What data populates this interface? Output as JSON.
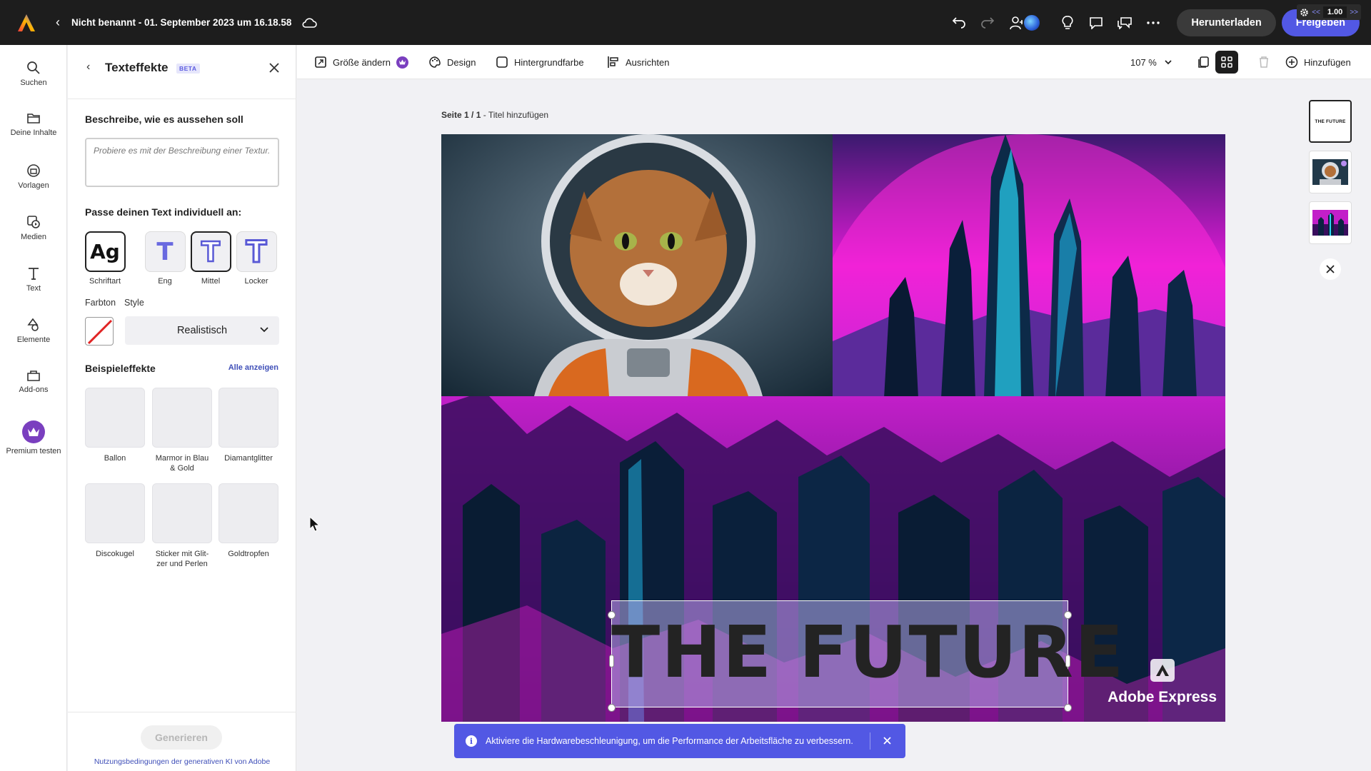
{
  "topbar": {
    "title": "Nicht benannt - 01. September 2023 um 16.18.58",
    "download_label": "Herunterladen",
    "share_label": "Freigeben",
    "speed_value": "1.00",
    "speed_prev": "<<",
    "speed_next": ">>"
  },
  "rail": {
    "items": [
      {
        "label": "Suchen",
        "icon": "search-icon"
      },
      {
        "label": "Deine Inhalte",
        "icon": "folder-icon"
      },
      {
        "label": "Vorlagen",
        "icon": "templates-icon"
      },
      {
        "label": "Medien",
        "icon": "media-icon"
      },
      {
        "label": "Text",
        "icon": "text-icon"
      },
      {
        "label": "Elemente",
        "icon": "elements-icon"
      },
      {
        "label": "Add-ons",
        "icon": "addons-icon"
      },
      {
        "label": "Premium testen",
        "icon": "crown-icon"
      }
    ]
  },
  "panel": {
    "title": "Texteffekte",
    "badge": "BETA",
    "describe_title": "Beschreibe, wie es aussehen soll",
    "describe_placeholder": "Probiere es mit der Beschreibung einer Textur.",
    "customize_title": "Passe deinen Text individuell an:",
    "options": [
      {
        "label": "Schriftart",
        "glyph": "Ag"
      },
      {
        "label": "Eng",
        "glyph": "T"
      },
      {
        "label": "Mittel",
        "glyph": "T"
      },
      {
        "label": "Locker",
        "glyph": "T"
      }
    ],
    "hue_label": "Farbton",
    "style_label": "Style",
    "style_value": "Realistisch",
    "examples_title": "Beispieleffekte",
    "show_all": "Alle anzeigen",
    "examples": [
      {
        "label": "Ballon"
      },
      {
        "label": "Marmor in Blau & Gold"
      },
      {
        "label": "Diamantglitter"
      },
      {
        "label": "Discokugel"
      },
      {
        "label": "Sticker mit Glit-zer und Perlen"
      },
      {
        "label": "Goldtropfen"
      }
    ],
    "generate_label": "Generieren",
    "terms": "Nutzungsbedingungen der generativen KI von Adobe"
  },
  "toolbar": {
    "resize": "Größe ändern",
    "design": "Design",
    "background": "Hintergrundfarbe",
    "align": "Ausrichten",
    "zoom": "107 %",
    "add": "Hinzufügen"
  },
  "canvas": {
    "page_number": "Seite 1 / 1",
    "page_title": " - Titel hinzufügen",
    "headline": "THE FUTURE",
    "watermark": "Adobe Express"
  },
  "thumbs": {
    "first_text": "THE FUTURE"
  },
  "toast": {
    "message": "Aktiviere die Hardwarebeschleunigung, um die Performance der Arbeitsfläche zu verbessern."
  },
  "colors": {
    "accent": "#5258e4",
    "topbar": "#1d1d1d",
    "link": "#3f4fb8",
    "neon_magenta": "#ff1fe0",
    "neon_cyan": "#29d3f2"
  }
}
